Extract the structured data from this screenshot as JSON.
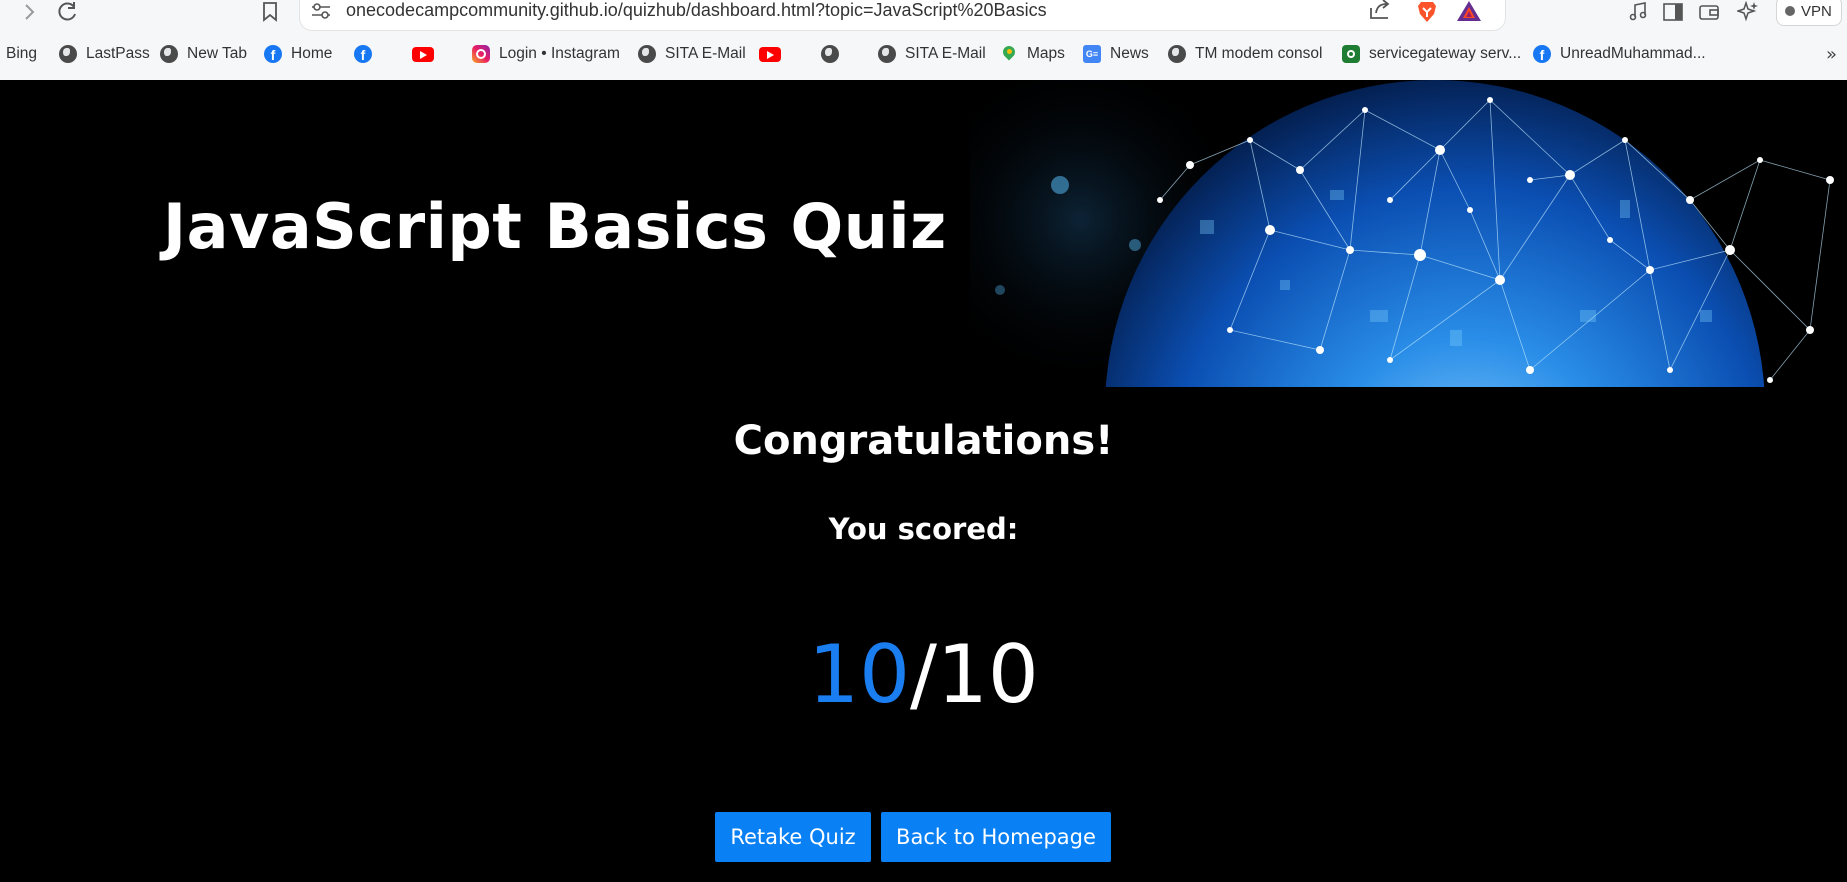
{
  "browser": {
    "url": "onecodecampcommunity.github.io/quizhub/dashboard.html?topic=JavaScript%20Basics",
    "vpn_label": "VPN",
    "bookmarks": [
      {
        "label": "Bing",
        "icon": "none"
      },
      {
        "label": "LastPass",
        "icon": "globe-icon"
      },
      {
        "label": "New Tab",
        "icon": "globe-icon"
      },
      {
        "label": "Home",
        "icon": "facebook-icon"
      },
      {
        "label": "",
        "icon": "facebook-icon"
      },
      {
        "label": "",
        "icon": "youtube-icon"
      },
      {
        "label": "Login • Instagram",
        "icon": "instagram-icon"
      },
      {
        "label": "SITA E-Mail",
        "icon": "globe-icon"
      },
      {
        "label": "",
        "icon": "youtube-icon"
      },
      {
        "label": "",
        "icon": "globe-icon"
      },
      {
        "label": "SITA E-Mail",
        "icon": "globe-icon"
      },
      {
        "label": "Maps",
        "icon": "maps-icon"
      },
      {
        "label": "News",
        "icon": "news-icon"
      },
      {
        "label": "TM modem consol",
        "icon": "globe-icon"
      },
      {
        "label": "servicegateway serv...",
        "icon": "servicegateway-icon"
      },
      {
        "label": "UnreadMuhammad...",
        "icon": "facebook-icon"
      }
    ],
    "more_label": "»"
  },
  "quiz": {
    "title": "JavaScript Basics Quiz",
    "congrats": "Congratulations!",
    "scored_label": "You scored:",
    "score": "10",
    "separator": "/",
    "total": "10",
    "retake_label": "Retake Quiz",
    "home_label": "Back to Homepage"
  },
  "colors": {
    "background": "#000000",
    "accent": "#0a80f5",
    "score_color": "#1a7df0"
  }
}
